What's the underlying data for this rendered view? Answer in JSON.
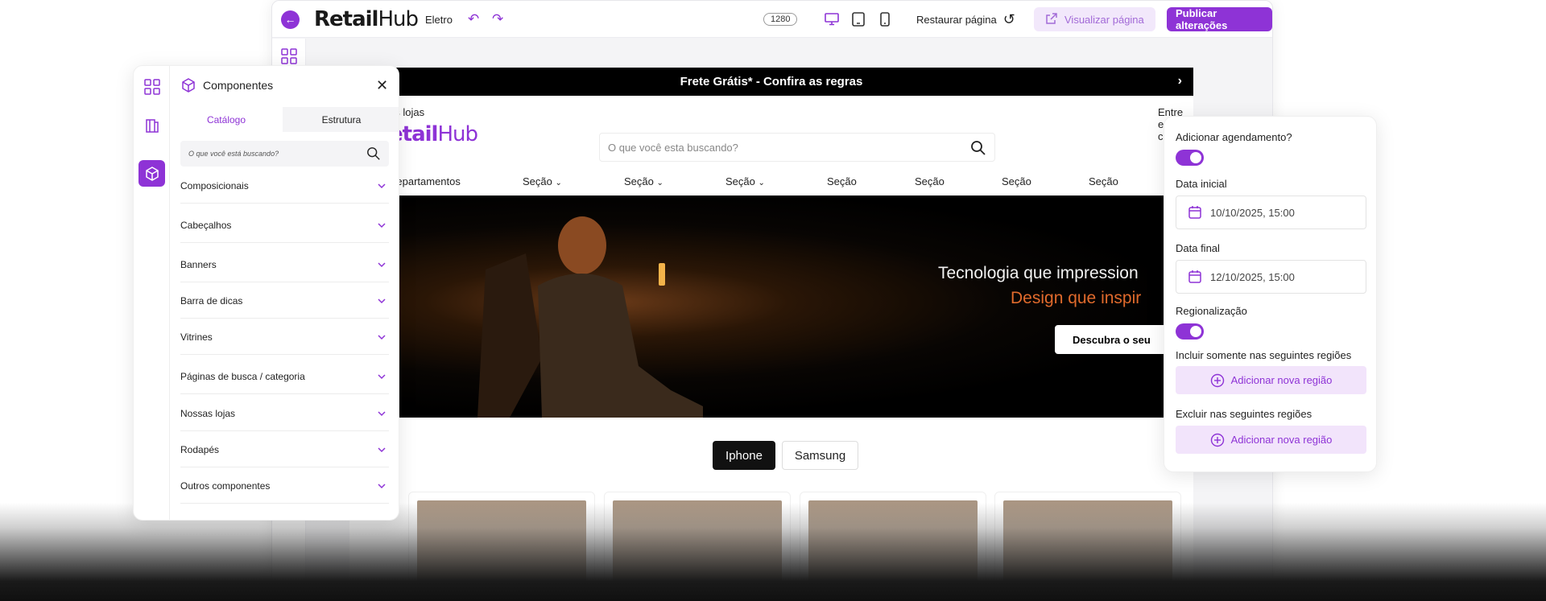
{
  "colors": {
    "accent": "#8e33d6",
    "accent_light": "#f2e8fb",
    "promo_bg": "#000000",
    "hero_orange": "#e06a2c"
  },
  "topbar": {
    "logo_bold": "Retail",
    "logo_light": "Hub",
    "store_name": "Eletro",
    "width_value": "1280",
    "restore_label": "Restaurar página",
    "view_label": "Visualizar página",
    "publish_label": "Publicar alterações"
  },
  "preview": {
    "promo_text": "Frete Grátis* - Confira as regras",
    "stores_link": "as lojas",
    "contact_link": "Entre em contato",
    "logo_bold": "etail",
    "logo_light": "Hub",
    "search_placeholder": "O que você esta buscando?",
    "nav": [
      "Departamentos",
      "Seção",
      "Seção",
      "Seção",
      "Seção",
      "Seção",
      "Seção",
      "Seção"
    ],
    "hero_line1": "Tecnologia que impression",
    "hero_line2": "Design que inspir",
    "hero_button": "Descubra o seu",
    "chips": [
      "Iphone",
      "Samsung"
    ]
  },
  "components_panel": {
    "title": "Componentes",
    "tabs": [
      "Catálogo",
      "Estrutura"
    ],
    "search_placeholder": "O que você está buscando?",
    "items": [
      "Composicionais",
      "Cabeçalhos",
      "Banners",
      "Barra de dicas",
      "Vitrines",
      "Páginas de busca / categoria",
      "Nossas lojas",
      "Rodapés",
      "Outros componentes"
    ]
  },
  "schedule_panel": {
    "add_schedule_label": "Adicionar agendamento?",
    "start_label": "Data inicial",
    "start_value": "10/10/2025, 15:00",
    "end_label": "Data final",
    "end_value": "12/10/2025, 15:00",
    "regionalization_label": "Regionalização",
    "include_label": "Incluir somente nas seguintes regiões",
    "exclude_label": "Excluir nas seguintes regiões",
    "add_region_label": "Adicionar nova região"
  }
}
